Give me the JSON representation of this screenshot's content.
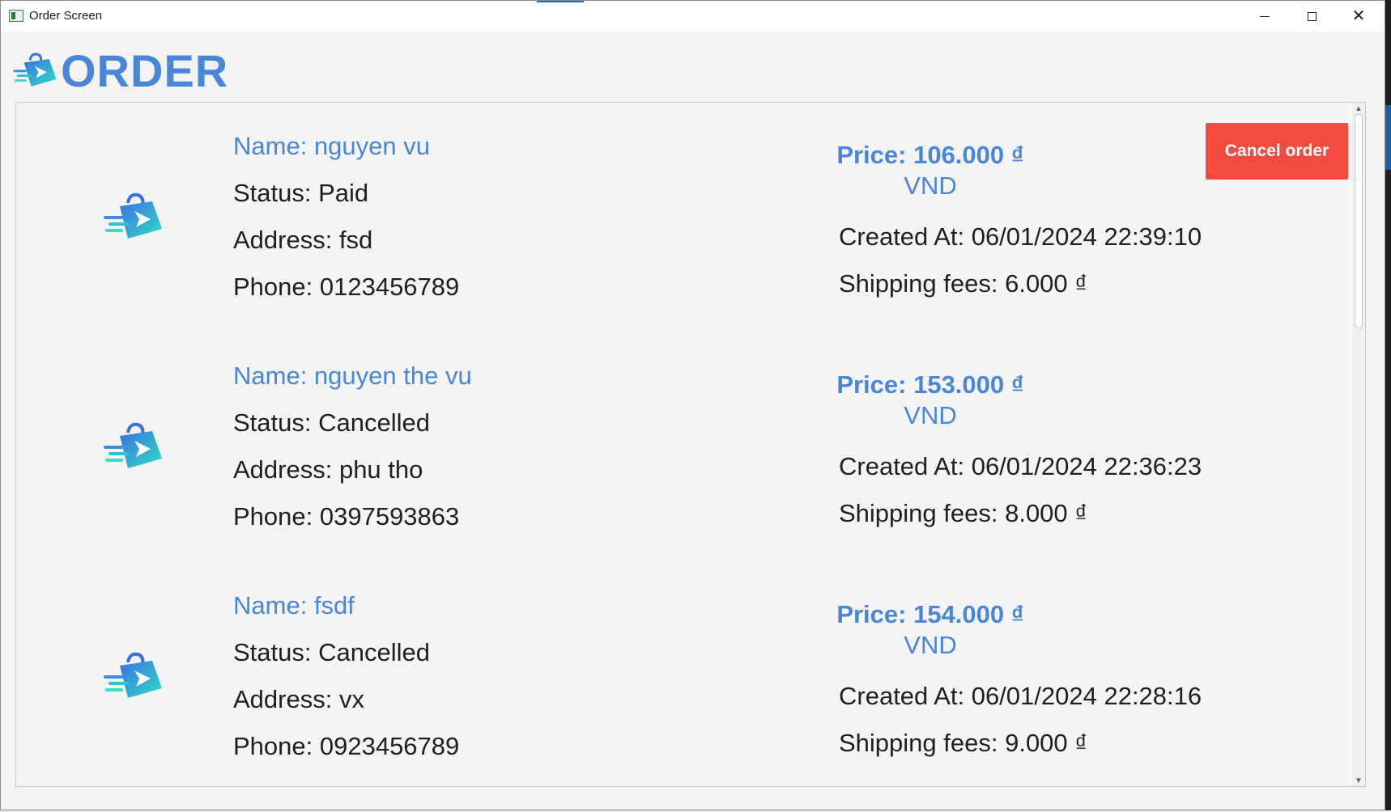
{
  "window": {
    "title": "Order Screen",
    "controls": {
      "minimize": "minimize-icon",
      "maximize": "maximize-icon",
      "close": "close-icon"
    }
  },
  "header": {
    "title": "ORDER"
  },
  "colors": {
    "accent_blue": "#4a86d8",
    "cancel_red": "#f44a3f",
    "logo_gradient_start": "#3b6fe0",
    "logo_gradient_end": "#2fe0c6"
  },
  "orders": [
    {
      "name": "Name: nguyen vu",
      "status": "Status: Paid",
      "address": "Address: fsd",
      "phone": "Phone: 0123456789",
      "price": "Price: 106.000 ₫",
      "currency": "VND",
      "created_at": "Created At: 06/01/2024 22:39:10",
      "shipping": "Shipping fees: 6.000 ₫",
      "cancel_label": "Cancel order"
    },
    {
      "name": "Name: nguyen the vu",
      "status": "Status: Cancelled",
      "address": "Address: phu tho",
      "phone": "Phone: 0397593863",
      "price": "Price: 153.000 ₫",
      "currency": "VND",
      "created_at": "Created At: 06/01/2024 22:36:23",
      "shipping": "Shipping fees: 8.000 ₫"
    },
    {
      "name": "Name: fsdf",
      "status": "Status: Cancelled",
      "address": "Address: vx",
      "phone": "Phone: 0923456789",
      "price": "Price: 154.000 ₫",
      "currency": "VND",
      "created_at": "Created At: 06/01/2024 22:28:16",
      "shipping": "Shipping fees: 9.000 ₫"
    }
  ]
}
